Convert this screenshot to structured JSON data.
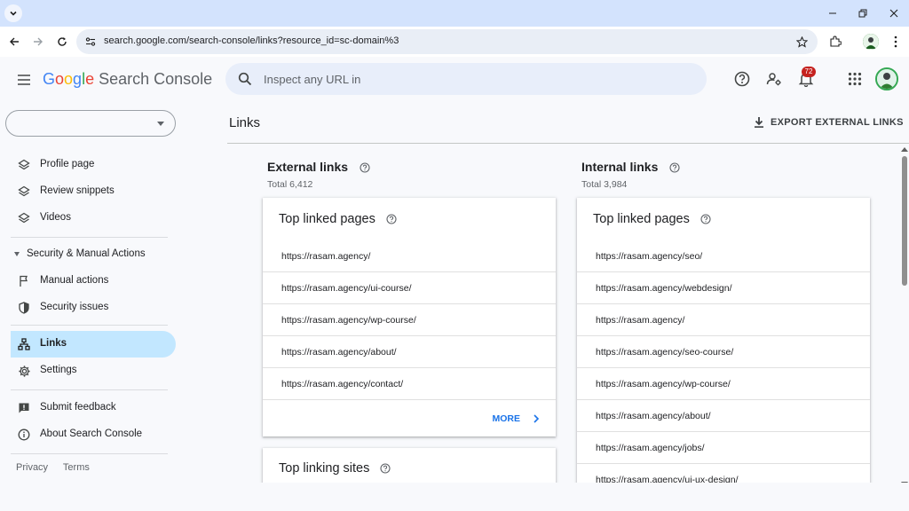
{
  "browser": {
    "url": "search.google.com/search-console/links?resource_id=sc-domain%3"
  },
  "header": {
    "logo_google": [
      "G",
      "o",
      "o",
      "g",
      "l",
      "e"
    ],
    "logo_product": "Search Console",
    "search_placeholder": "Inspect any URL in",
    "notification_count": "72"
  },
  "sidebar": {
    "property_value": "",
    "items_top": [
      {
        "label": "Profile page",
        "icon": "layers-icon"
      },
      {
        "label": "Review snippets",
        "icon": "layers-icon"
      },
      {
        "label": "Videos",
        "icon": "layers-icon"
      }
    ],
    "section_title": "Security & Manual Actions",
    "section_items": [
      {
        "label": "Manual actions",
        "icon": "flag-icon"
      },
      {
        "label": "Security issues",
        "icon": "shield-icon"
      }
    ],
    "links_label": "Links",
    "settings_label": "Settings",
    "feedback_label": "Submit feedback",
    "about_label": "About Search Console",
    "privacy": "Privacy",
    "terms": "Terms"
  },
  "main": {
    "page_title": "Links",
    "export_label": "EXPORT EXTERNAL LINKS",
    "external": {
      "title": "External links",
      "total": "Total 6,412",
      "top_pages_title": "Top linked pages",
      "top_pages": [
        "https://rasam.agency/",
        "https://rasam.agency/ui-course/",
        "https://rasam.agency/wp-course/",
        "https://rasam.agency/about/",
        "https://rasam.agency/contact/"
      ],
      "more_label": "MORE",
      "top_sites_title": "Top linking sites"
    },
    "internal": {
      "title": "Internal links",
      "total": "Total 3,984",
      "top_pages_title": "Top linked pages",
      "top_pages": [
        "https://rasam.agency/seo/",
        "https://rasam.agency/webdesign/",
        "https://rasam.agency/",
        "https://rasam.agency/seo-course/",
        "https://rasam.agency/wp-course/",
        "https://rasam.agency/about/",
        "https://rasam.agency/jobs/",
        "https://rasam.agency/ui-ux-design/"
      ]
    }
  },
  "colors": {
    "accent": "#1a73e8",
    "active_nav": "#c2e7ff",
    "badge": "#c5221f"
  }
}
